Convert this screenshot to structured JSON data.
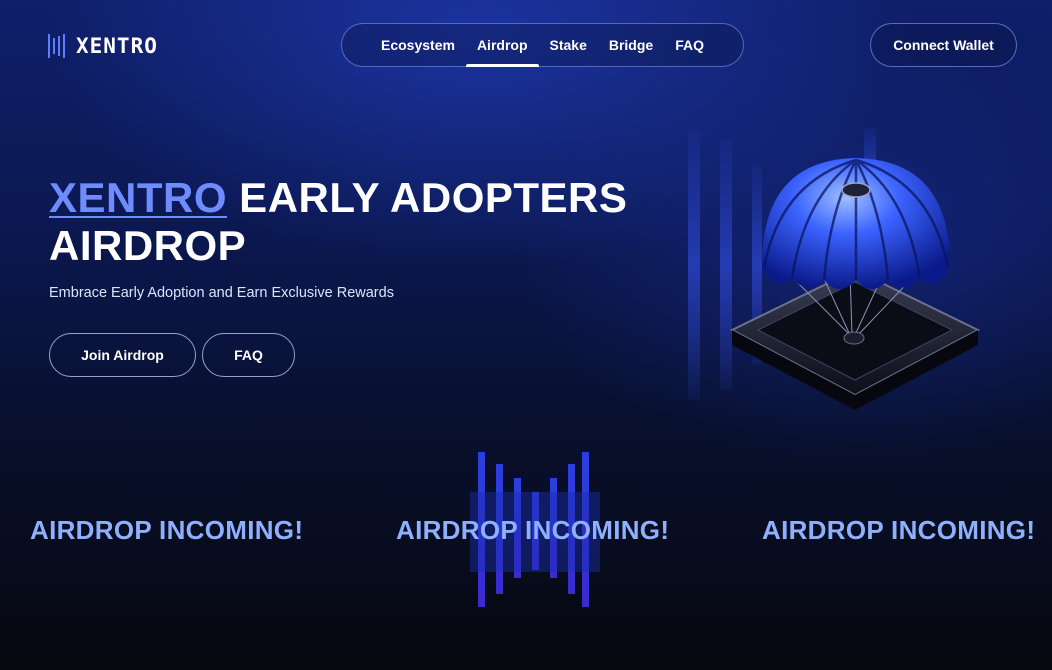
{
  "brand": {
    "name": "XENTRO",
    "logo_icon": "xentro-logo-icon"
  },
  "nav": {
    "items": [
      {
        "label": "Ecosystem",
        "active": false
      },
      {
        "label": "Airdrop",
        "active": true
      },
      {
        "label": "Stake",
        "active": false
      },
      {
        "label": "Bridge",
        "active": false
      },
      {
        "label": "FAQ",
        "active": false
      }
    ]
  },
  "header": {
    "connect_label": "Connect Wallet"
  },
  "hero": {
    "title_accent": "XENTRO",
    "title_line1_rest": " EARLY ADOPTERS",
    "title_line2": "AIRDROP",
    "subtitle": "Embrace Early Adoption and Earn Exclusive Rewards",
    "join_label": "Join Airdrop",
    "faq_label": "FAQ",
    "illustration": "parachute-crate-illustration"
  },
  "marquee": {
    "items": [
      "AIRDROP INCOMING!",
      "AIRDROP INCOMING!",
      "AIRDROP INCOMING!"
    ]
  },
  "colors": {
    "accent": "#6f8cff",
    "marquee": "#8fb0ff",
    "bg_top": "#0f1f6a",
    "bg_bottom": "#07090f"
  }
}
